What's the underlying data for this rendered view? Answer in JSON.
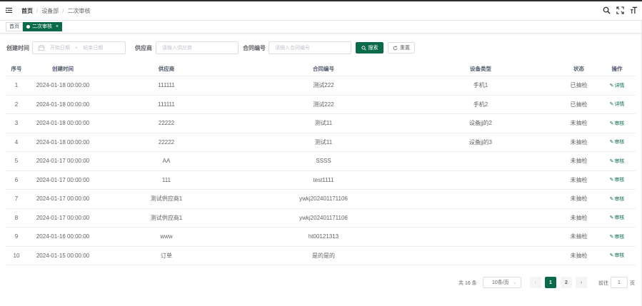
{
  "header": {
    "breadcrumb": [
      "首页",
      "设备部",
      "二次审核"
    ]
  },
  "tags": {
    "home": "首页",
    "active": "二次审核",
    "close": "×"
  },
  "search": {
    "created_label": "创建时间",
    "start_placeholder": "开始日期",
    "date_sep": "-",
    "end_placeholder": "结束日期",
    "supplier_label": "供应商",
    "supplier_placeholder": "请输入供应商",
    "contract_label": "合同编号",
    "contract_placeholder": "请输入合同编号",
    "search_btn": "搜索",
    "reset_btn": "重置"
  },
  "table": {
    "columns": [
      "序号",
      "创建时间",
      "供应商",
      "合同编号",
      "设备类型",
      "状态",
      "操作"
    ],
    "rows": [
      {
        "no": "1",
        "time": "2024-01-18 00:00:00",
        "supplier": "111111",
        "contract": "测试222",
        "type": "手机1",
        "status": "已抽检",
        "op": "详情"
      },
      {
        "no": "2",
        "time": "2024-01-18 00:00:00",
        "supplier": "111111",
        "contract": "测试222",
        "type": "手机2",
        "status": "已抽检",
        "op": "详情"
      },
      {
        "no": "3",
        "time": "2024-01-18 00:00:00",
        "supplier": "22222",
        "contract": "测试11",
        "type": "设备jj的2",
        "status": "未抽检",
        "op": "审核"
      },
      {
        "no": "4",
        "time": "2024-01-18 00:00:00",
        "supplier": "22222",
        "contract": "测试11",
        "type": "设备jj的3",
        "status": "未抽检",
        "op": "审核"
      },
      {
        "no": "5",
        "time": "2024-01-17 00:00:00",
        "supplier": "AA",
        "contract": "SSSS",
        "type": "",
        "status": "未抽检",
        "op": "审核"
      },
      {
        "no": "6",
        "time": "2024-01-17 00:00:00",
        "supplier": "111",
        "contract": "test1111",
        "type": "",
        "status": "未抽检",
        "op": "审核"
      },
      {
        "no": "7",
        "time": "2024-01-17 00:00:00",
        "supplier": "测试供应商1",
        "contract": "ywkj202401171106",
        "type": "",
        "status": "未抽检",
        "op": "审核"
      },
      {
        "no": "8",
        "time": "2024-01-17 00:00:00",
        "supplier": "测试供应商1",
        "contract": "ywkj202401171106",
        "type": "",
        "status": "未抽检",
        "op": "审核"
      },
      {
        "no": "9",
        "time": "2024-01-16 00:00:00",
        "supplier": "www",
        "contract": "ht00121313",
        "type": "",
        "status": "未抽检",
        "op": "审核"
      },
      {
        "no": "10",
        "time": "2024-01-15 00:00:00",
        "supplier": "订单",
        "contract": "是的是的",
        "type": "",
        "status": "未抽检",
        "op": "审核"
      }
    ]
  },
  "pagination": {
    "total": "共 16 条",
    "page_size": "10条/页",
    "pages": [
      "1",
      "2"
    ],
    "goto_label": "前往",
    "goto_value": "1",
    "page_unit": "页"
  },
  "colors": {
    "primary": "#0a6b4c"
  }
}
